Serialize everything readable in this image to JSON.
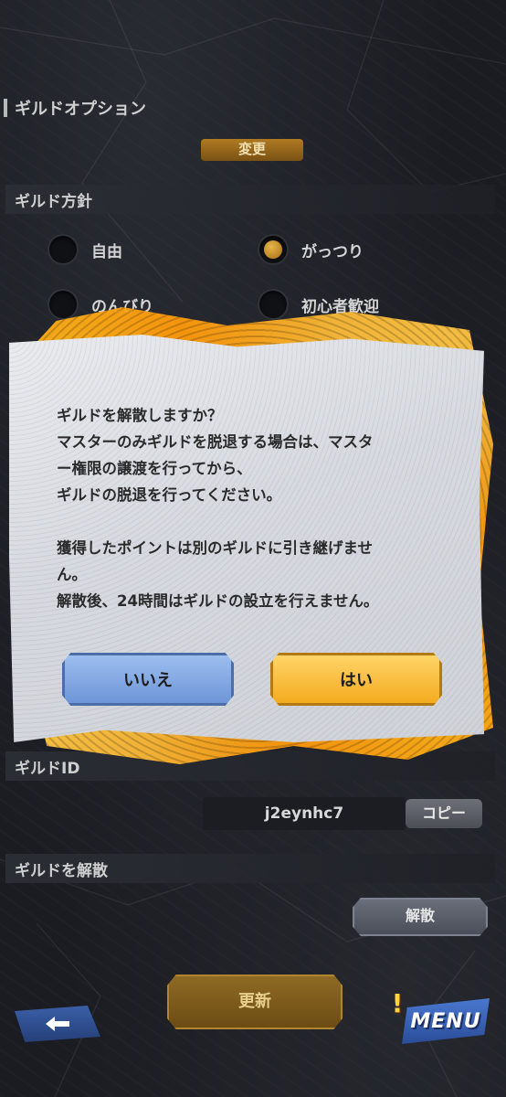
{
  "page": {
    "title": "ギルドオプション",
    "top_button_label": "変更"
  },
  "policy": {
    "header": "ギルド方針",
    "options": [
      {
        "label": "自由",
        "selected": false
      },
      {
        "label": "がっつり",
        "selected": true
      },
      {
        "label": "のんびり",
        "selected": false
      },
      {
        "label": "初心者歓迎",
        "selected": false
      }
    ]
  },
  "dialog": {
    "message": "ギルドを解散しますか？\nマスターのみギルドを脱退する場合は、マスタ\nー権限の譲渡を行ってから、\nギルドの脱退を行ってください。\n\n獲得したポイントは別のギルドに引き継げませ\nん。\n解散後、24時間はギルドの設立を行えません。",
    "no_label": "いいえ",
    "yes_label": "はい"
  },
  "guild_id": {
    "header": "ギルドID",
    "value": "j2eynhc7",
    "copy_label": "コピー"
  },
  "dissolve": {
    "header": "ギルドを解散",
    "button_label": "解散"
  },
  "footer": {
    "update_label": "更新",
    "back_icon": "arrow-left-icon",
    "menu_label": "MENU",
    "alert_icon": "!"
  }
}
